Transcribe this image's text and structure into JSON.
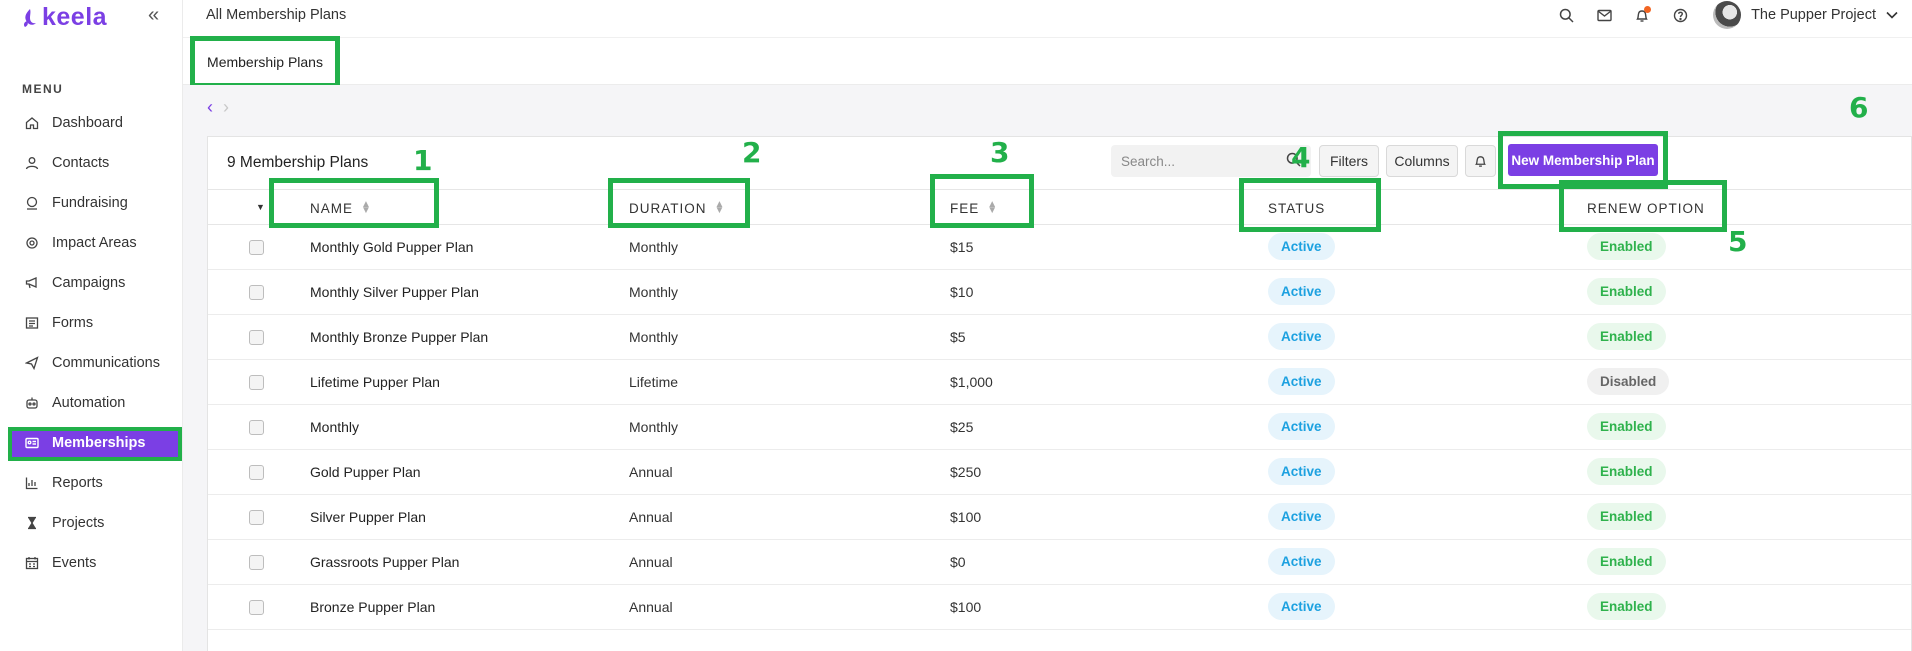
{
  "brand": {
    "name": "keela",
    "color": "#7b3fe4"
  },
  "sidebar": {
    "menu_heading": "MENU",
    "items": [
      {
        "label": "Dashboard",
        "icon": "home-icon"
      },
      {
        "label": "Contacts",
        "icon": "person-icon"
      },
      {
        "label": "Fundraising",
        "icon": "donation-icon"
      },
      {
        "label": "Impact Areas",
        "icon": "impact-icon"
      },
      {
        "label": "Campaigns",
        "icon": "megaphone-icon"
      },
      {
        "label": "Forms",
        "icon": "form-icon"
      },
      {
        "label": "Communications",
        "icon": "send-icon"
      },
      {
        "label": "Automation",
        "icon": "robot-icon"
      },
      {
        "label": "Memberships",
        "icon": "membership-card-icon",
        "active": true
      },
      {
        "label": "Reports",
        "icon": "chart-icon"
      },
      {
        "label": "Projects",
        "icon": "hourglass-icon"
      },
      {
        "label": "Events",
        "icon": "calendar-icon"
      }
    ]
  },
  "topbar": {
    "title": "All Membership Plans",
    "org_name": "The Pupper Project"
  },
  "tabs": {
    "active_label": "Membership Plans"
  },
  "card": {
    "count_label": "9 Membership Plans",
    "search_placeholder": "Search...",
    "filters_label": "Filters",
    "columns_label": "Columns",
    "new_button_label": "New Membership Plan"
  },
  "table": {
    "headers": {
      "name": "NAME",
      "duration": "DURATION",
      "fee": "FEE",
      "status": "STATUS",
      "renew": "RENEW OPTION"
    },
    "rows": [
      {
        "name": "Monthly Gold Pupper Plan",
        "duration": "Monthly",
        "fee": "$15",
        "status": "Active",
        "renew": "Enabled"
      },
      {
        "name": "Monthly Silver Pupper Plan",
        "duration": "Monthly",
        "fee": "$10",
        "status": "Active",
        "renew": "Enabled"
      },
      {
        "name": "Monthly Bronze Pupper Plan",
        "duration": "Monthly",
        "fee": "$5",
        "status": "Active",
        "renew": "Enabled"
      },
      {
        "name": "Lifetime Pupper Plan",
        "duration": "Lifetime",
        "fee": "$1,000",
        "status": "Active",
        "renew": "Disabled"
      },
      {
        "name": "Monthly",
        "duration": "Monthly",
        "fee": "$25",
        "status": "Active",
        "renew": "Enabled"
      },
      {
        "name": "Gold Pupper Plan",
        "duration": "Annual",
        "fee": "$250",
        "status": "Active",
        "renew": "Enabled"
      },
      {
        "name": "Silver Pupper Plan",
        "duration": "Annual",
        "fee": "$100",
        "status": "Active",
        "renew": "Enabled"
      },
      {
        "name": "Grassroots Pupper Plan",
        "duration": "Annual",
        "fee": "$0",
        "status": "Active",
        "renew": "Enabled"
      },
      {
        "name": "Bronze Pupper Plan",
        "duration": "Annual",
        "fee": "$100",
        "status": "Active",
        "renew": "Enabled"
      }
    ]
  },
  "annotations": {
    "n1": "1",
    "n2": "2",
    "n3": "3",
    "n4": "4",
    "n5": "5",
    "n6": "6",
    "color": "#22b04a"
  }
}
